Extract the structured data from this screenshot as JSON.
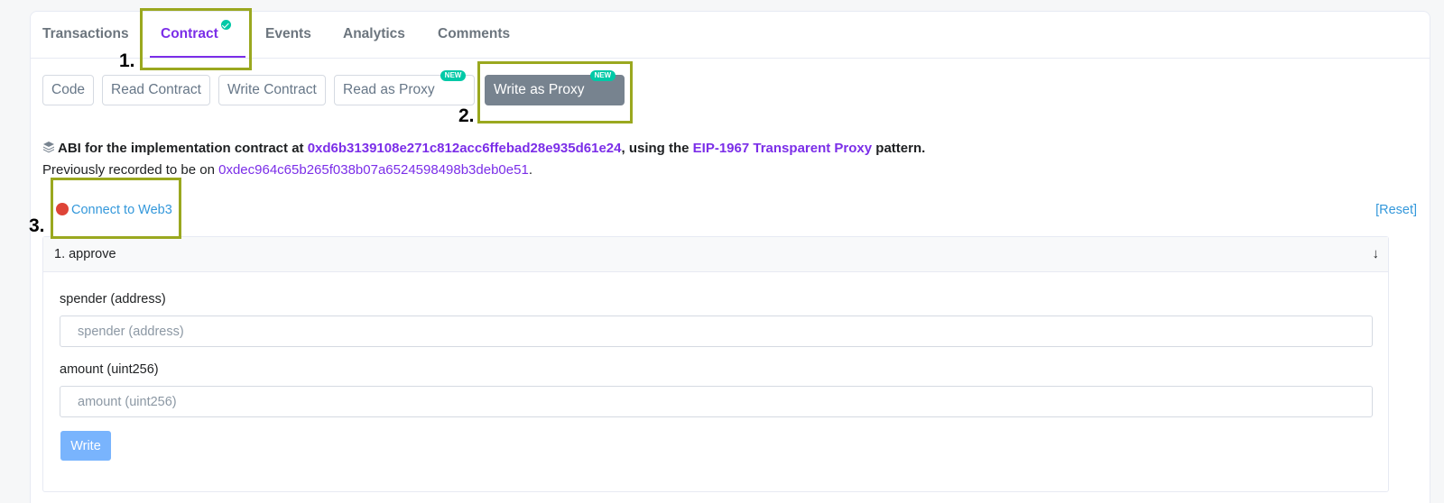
{
  "tabs": [
    {
      "label": "Transactions"
    },
    {
      "label": "Contract"
    },
    {
      "label": "Events"
    },
    {
      "label": "Analytics"
    },
    {
      "label": "Comments"
    }
  ],
  "subtabs": [
    {
      "label": "Code"
    },
    {
      "label": "Read Contract"
    },
    {
      "label": "Write Contract"
    },
    {
      "label": "Read as Proxy",
      "badge": "NEW"
    },
    {
      "label": "Write as Proxy",
      "badge": "NEW"
    }
  ],
  "abi": {
    "prefix": "ABI for the implementation contract at",
    "address": "0xd6b3139108e271c812acc6ffebad28e935d61e24",
    "middle": ", using the",
    "pattern": "EIP-1967 Transparent Proxy",
    "suffix": "pattern."
  },
  "previous": {
    "prefix": "Previously recorded to be on",
    "address": "0xdec964c65b265f038b07a6524598498b3deb0e51",
    "suffix": "."
  },
  "connect_label": "Connect to Web3",
  "reset_label": "[Reset]",
  "function": {
    "title": "1. approve",
    "arrow": "↓",
    "fields": [
      {
        "label": "spender (address)",
        "placeholder": "spender (address)"
      },
      {
        "label": "amount (uint256)",
        "placeholder": "amount (uint256)"
      }
    ],
    "button": "Write"
  },
  "annotations": [
    "1.",
    "2.",
    "3."
  ],
  "colors": {
    "accent_purple": "#7b2ee8",
    "annotation_box": "#9aa81f",
    "verified_check": "#00c9a7",
    "disconnected_dot": "#de4437",
    "link_blue": "#3498db",
    "write_button": "#79b4fd"
  }
}
